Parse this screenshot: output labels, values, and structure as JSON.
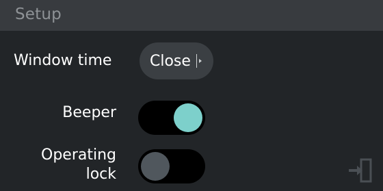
{
  "header": {
    "title": "Setup"
  },
  "settings": {
    "window_time": {
      "label": "Window time",
      "value": "Close"
    },
    "beeper": {
      "label": "Beeper",
      "state": "on"
    },
    "operating_lock": {
      "label_line1": "Operating",
      "label_line2": "lock",
      "state": "off"
    }
  },
  "icons": {
    "exit": "exit-icon"
  },
  "colors": {
    "background": "#222528",
    "header": "#383b3f",
    "toggle_track": "#000000",
    "toggle_on_knob": "#7dd0cb",
    "toggle_off_knob": "#50575d",
    "select_bg": "#3b3f43"
  }
}
